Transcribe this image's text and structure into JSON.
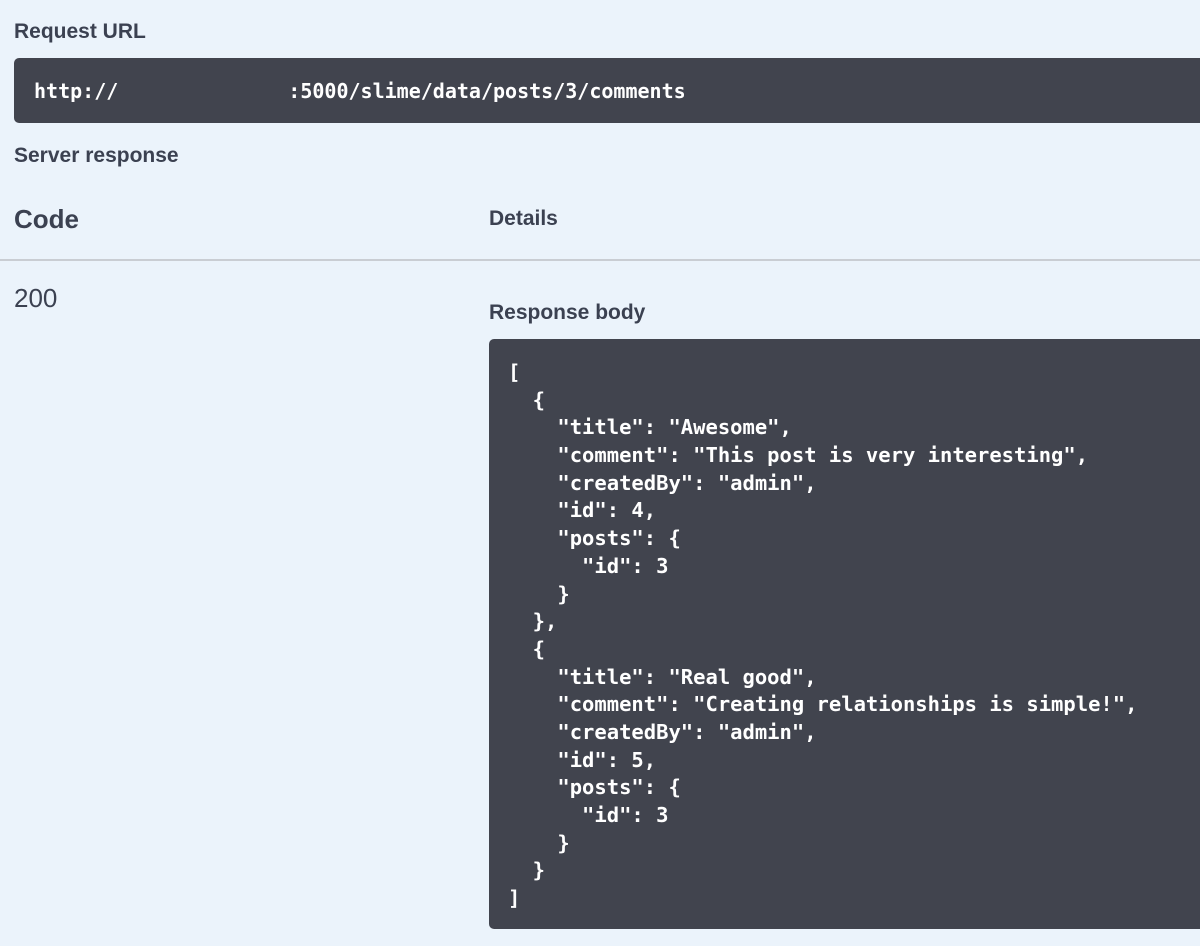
{
  "request_url": {
    "label": "Request URL",
    "scheme": "http://",
    "path": ":5000/slime/data/posts/3/comments"
  },
  "server_response": {
    "label": "Server response",
    "columns": {
      "code": "Code",
      "details": "Details"
    },
    "status_code": "200",
    "response_body_label": "Response body",
    "response_body_lines": [
      "[",
      "  {",
      "    \"title\": \"Awesome\",",
      "    \"comment\": \"This post is very interesting\",",
      "    \"createdBy\": \"admin\",",
      "    \"id\": 4,",
      "    \"posts\": {",
      "      \"id\": 3",
      "    }",
      "  },",
      "  {",
      "    \"title\": \"Real good\",",
      "    \"comment\": \"Creating relationships is simple!\",",
      "    \"createdBy\": \"admin\",",
      "    \"id\": 5,",
      "    \"posts\": {",
      "      \"id\": 3",
      "    }",
      "  }",
      "]"
    ]
  }
}
